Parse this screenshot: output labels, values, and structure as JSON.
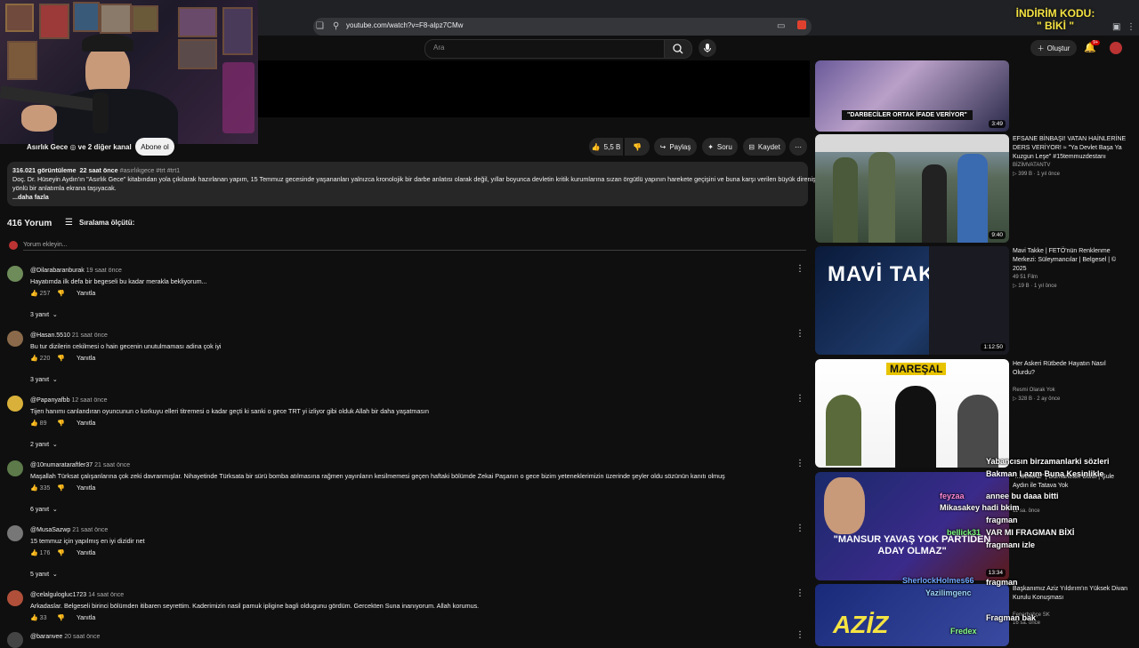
{
  "browser": {
    "url": "youtube.com/watch?v=F8-alpz7CMw"
  },
  "promo": {
    "line1": "İNDİRİM KODU:",
    "line2": "\" BİKİ \""
  },
  "header": {
    "search_placeholder": "Ara",
    "create_label": "Oluştur",
    "notif_count": "9+"
  },
  "video": {
    "channel_text": "Asırlık Gece ◎ ve 2 diğer kanal",
    "subscribe_label": "Abone ol",
    "likes": "5,5 B",
    "share_label": "Paylaş",
    "ask_label": "Soru",
    "save_label": "Kaydet"
  },
  "description": {
    "views": "316.021 görüntüleme",
    "ago": "22 saat önce",
    "tags": "#asırlıkgece #trt #trt1",
    "line1": "Doç. Dr. Hüseyin Aydın'ın \"Asırlık Gece\" kitabından yola çıkılarak hazırlanan yapım, 15 Temmuz gecesinde yaşananları yalnızca kronolojik bir darbe anlatısı olarak değil, yıllar boyunca devletin kritik kurumlarına sızan örgütlü yapının harekete geçişini ve buna karşı verilen büyük direnişi çok",
    "line2": "yönlü bir anlatımla ekrana taşıyacak.",
    "more": "...daha fazla"
  },
  "comments_header": {
    "count": "416 Yorum",
    "sort_label": "Sıralama ölçütü:",
    "add_placeholder": "Yorum ekleyin..."
  },
  "comments": [
    {
      "author": "@Dilarabaranburak",
      "time": "19 saat önce",
      "text": "Hayatımda ilk defa bir begeseli bu kadar merakla bekliyorum...",
      "likes": "257",
      "reply": "Yanıtla",
      "replies": "3 yanıt",
      "color": "#6e8c5a"
    },
    {
      "author": "@Hasan.5510",
      "time": "21 saat önce",
      "text": "Bu tur dizilerin cekilmesi o hain gecenin unutulmaması adina çok iyi",
      "likes": "220",
      "reply": "Yanıtla",
      "replies": "3 yanıt",
      "color": "#8a6a4a"
    },
    {
      "author": "@Papanyafbb",
      "time": "12 saat önce",
      "text": "Tijen hanımı canlandıran oyuncunun o korkuyu elleri titremesi o kadar geçti ki sanki o gece TRT yi izliyor gibi olduk Allah bir daha yaşatmasın",
      "likes": "89",
      "reply": "Yanıtla",
      "replies": "2 yanıt",
      "color": "#d9b13a"
    },
    {
      "author": "@10numarataraftler37",
      "time": "21 saat önce",
      "text": "Maşallah Türksat çalışanlarına çok zeki davranmışlar. Nihayetinde Türksata bir sürü bomba atılmasına rağmen yayınların kesilmemesi geçen haftaki bölümde Zekai Paşanın o gece bizim yeteneklerimizin üzerinde şeyler oldu sözünün kanıtı olmuş",
      "likes": "335",
      "reply": "Yanıtla",
      "replies": "6 yanıt",
      "color": "#5c7a4a"
    },
    {
      "author": "@MusaSazwp",
      "time": "21 saat önce",
      "text": "15 temmuz için yapılmış en iyi dizidir net",
      "likes": "176",
      "reply": "Yanıtla",
      "replies": "5 yanıt",
      "color": "#777777"
    },
    {
      "author": "@celalgulogluc1723",
      "time": "14 saat önce",
      "text": "Arkadaslar. Belgeseli birinci bölümden itibaren seyrettim. Kaderimizin nasil pamuk ipligine bagli oldugunu gördüm. Gercekten Suna inanıyorum. Allah korumus.",
      "likes": "33",
      "reply": "Yanıtla",
      "replies": "",
      "color": "#b0503a"
    },
    {
      "author": "@baranvee",
      "time": "20 saat önce",
      "text": "",
      "likes": "",
      "reply": "",
      "replies": "",
      "color": "#444444"
    }
  ],
  "sidebar": [
    {
      "thumb_text": "\"DARBECİLER ORTAK İFADE VERİYOR\"",
      "duration": "3:49",
      "title": "",
      "channel": "",
      "meta": ""
    },
    {
      "thumb_text": "",
      "duration": "9:40",
      "title": "EFSANE BİNBAŞI! VATAN HAİNLERİNE DERS VERİYOR! ≈ \"Ya Devlet Başa Ya Kuzgun Leşe\" #15temmuzdestanı",
      "channel": "BİZİMVATANTV",
      "meta": "▷ 399 B · 1 yıl önce"
    },
    {
      "thumb_text": "MAVİ TAKKE",
      "duration": "1:12:50",
      "title": "Mavi Takke | FETÖ'nün Renklenme Merkezi: Süleymancılar | Belgesel | © 2025",
      "channel": "49 51 Film",
      "meta": "▷ 19 B · 1 yıl önce"
    },
    {
      "thumb_text": "MAREŞAL",
      "duration": "",
      "title": "Her Askeri Rütbede Hayatın Nasıl Olurdu?",
      "channel": "Resmi Olarak Yok",
      "meta": "▷ 328 B · 2 ay önce"
    },
    {
      "thumb_text": "\"MANSUR YAVAŞ YOK PARTİDEN ADAY OLMAZ\"",
      "duration": "13:34",
      "title": "\"...OLMAZ\" | Burhanettin Bulut | Şule Aydın ile Tatava Yok",
      "channel": "",
      "meta": "11 sa. önce"
    },
    {
      "thumb_text": "AZİZ",
      "duration": "",
      "title": "Başkanımız Aziz Yıldırım'ın Yüksek Divan Kurulu Konuşması",
      "channel": "Fenerbahçe SK",
      "meta": "16 sa. önce"
    }
  ],
  "chat": [
    {
      "text": "Yabancısın birzamanlarki sözleri",
      "color": "#ffffff"
    },
    {
      "text": "Bakman Lazım Buna Kesinlikle",
      "color": "#ffffff"
    },
    {
      "text": "feyzaa",
      "color": "#ff8ad8"
    },
    {
      "text": "annee bu daaa bitti",
      "color": "#ffffff"
    },
    {
      "text": "Mikasakey hadi bkim",
      "color": "#ffffff"
    },
    {
      "text": "fragman",
      "color": "#ffffff"
    },
    {
      "text": "bellick31",
      "color": "#7cff7c"
    },
    {
      "text": "VAR MI FRAGMAN BİXİ",
      "color": "#ffffff"
    },
    {
      "text": "fragmanı izle",
      "color": "#ffffff"
    },
    {
      "text": "SherlockHolmes66",
      "color": "#6fa8ff"
    },
    {
      "text": "fragman",
      "color": "#ffffff"
    },
    {
      "text": "Yazilimgenc",
      "color": "#9fd8ff"
    },
    {
      "text": "Fragman bak",
      "color": "#ffffff"
    },
    {
      "text": "Fredex",
      "color": "#8aff8a"
    }
  ]
}
